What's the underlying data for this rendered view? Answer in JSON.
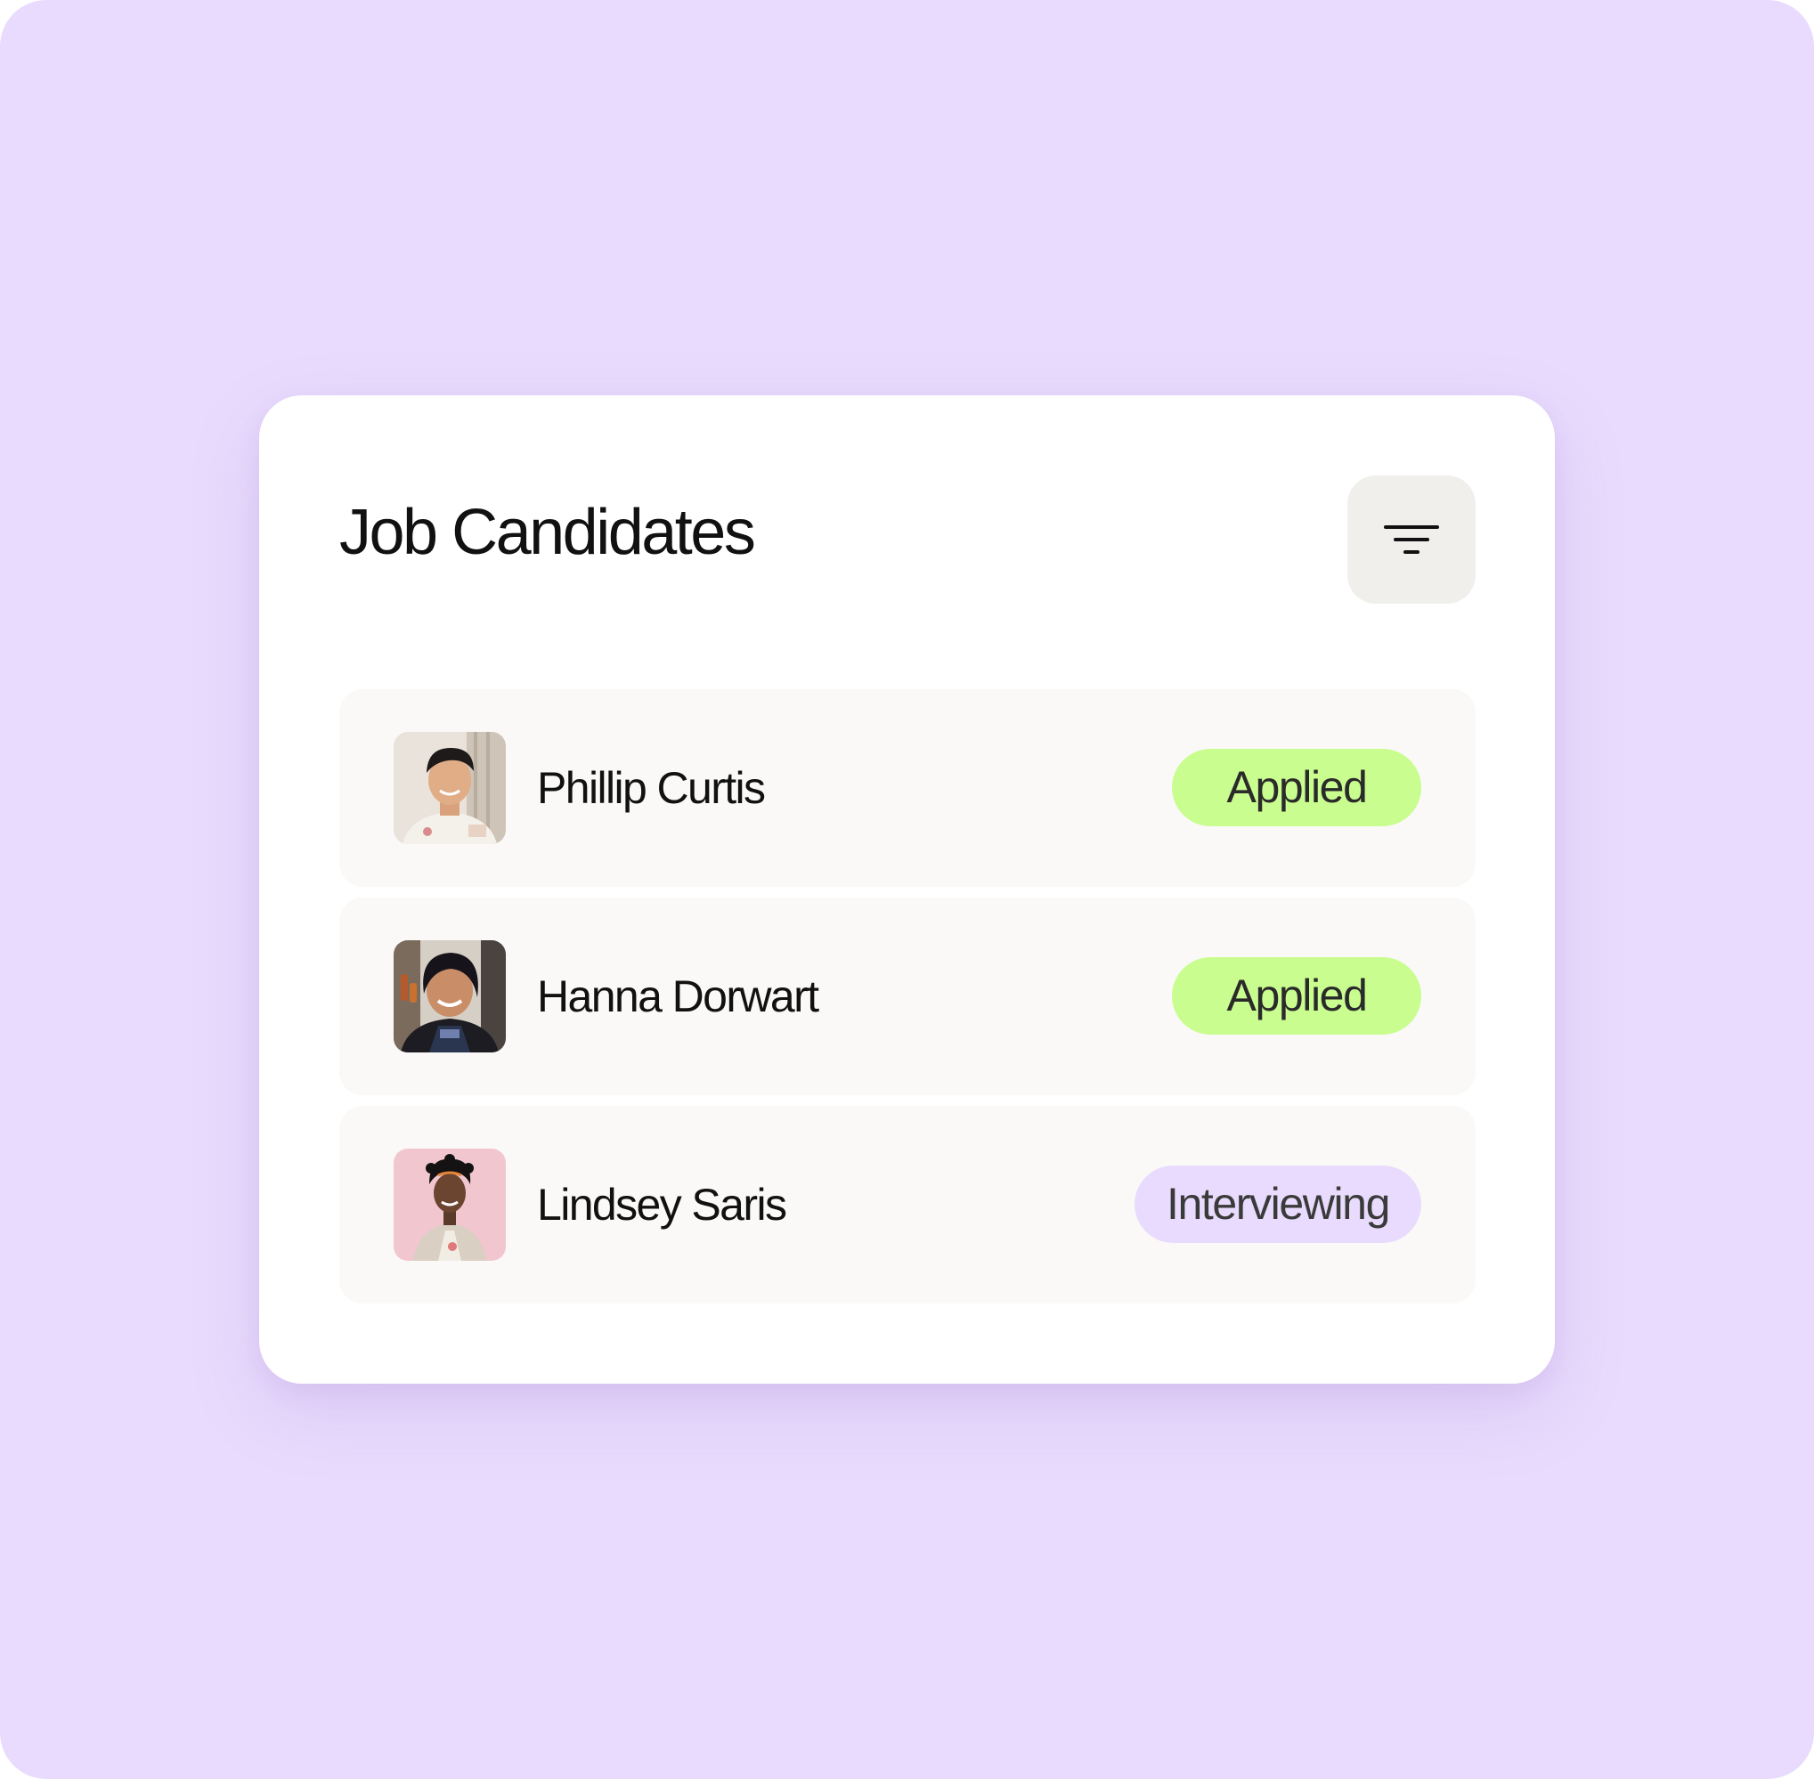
{
  "card": {
    "title": "Job Candidates"
  },
  "filter_button": {
    "icon": "filter-icon"
  },
  "candidates": [
    {
      "name": "Phillip Curtis",
      "status": "Applied",
      "status_color": "#c9fd8f"
    },
    {
      "name": "Hanna Dorwart",
      "status": "Applied",
      "status_color": "#c9fd8f"
    },
    {
      "name": "Lindsey Saris",
      "status": "Interviewing",
      "status_color": "#e9dbfd"
    }
  ],
  "colors": {
    "background": "#e9dbfd",
    "card": "#ffffff",
    "row": "#faf9f7",
    "applied": "#c9fd8f",
    "interviewing": "#e9dbfd"
  }
}
